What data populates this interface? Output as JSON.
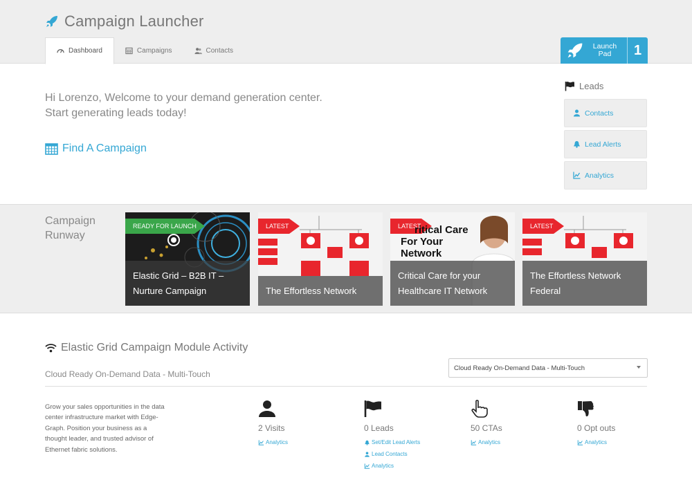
{
  "header": {
    "app_title": "Campaign Launcher",
    "tabs": [
      {
        "label": "Dashboard",
        "icon": "dashboard-icon",
        "active": true
      },
      {
        "label": "Campaigns",
        "icon": "calendar-icon",
        "active": false
      },
      {
        "label": "Contacts",
        "icon": "users-icon",
        "active": false
      }
    ],
    "launch_pad": {
      "label_line1": "Launch",
      "label_line2": "Pad",
      "count": "1"
    }
  },
  "welcome": {
    "line1": "Hi Lorenzo, Welcome to your demand generation center.",
    "line2": "Start generating leads today!",
    "find_campaign": "Find A Campaign"
  },
  "leads": {
    "title": "Leads",
    "buttons": [
      {
        "label": "Contacts",
        "icon": "user-icon"
      },
      {
        "label": "Lead Alerts",
        "icon": "bell-icon"
      },
      {
        "label": "Analytics",
        "icon": "chart-icon"
      }
    ]
  },
  "runway": {
    "title_line1": "Campaign",
    "title_line2": "Runway",
    "cards": [
      {
        "ribbon": "READY FOR LAUNCH",
        "title_line1": "Elastic Grid – B2B IT –",
        "title_line2": "Nurture Campaign"
      },
      {
        "ribbon": "LATEST",
        "title_line1": "The Effortless Network",
        "title_line2": ""
      },
      {
        "ribbon": "LATEST",
        "title_line1": "Critical Care for your",
        "title_line2": "Healthcare IT Network",
        "art_text_1": "ritical Care",
        "art_text_2": "For Your",
        "art_text_3": "Network"
      },
      {
        "ribbon": "LATEST",
        "title_line1": "The Effortless Network",
        "title_line2": "Federal"
      }
    ]
  },
  "activity": {
    "title": "Elastic Grid Campaign Module Activity",
    "subtitle": "Cloud Ready On-Demand Data - Multi-Touch",
    "select_value": "Cloud Ready On-Demand Data - Multi-Touch",
    "description": "Grow your sales opportunities in the data center infrastructure market with Edge-Graph. Position your business as a thought leader, and trusted advisor of Ethernet fabric solutions.",
    "stats": [
      {
        "value": "2 Visits",
        "icon": "user-icon",
        "links": [
          {
            "label": "Analytics",
            "icon": "chart-icon"
          }
        ]
      },
      {
        "value": "0 Leads",
        "icon": "flag-icon",
        "links": [
          {
            "label": "Set/Edit Lead Alerts",
            "icon": "bell-icon"
          },
          {
            "label": "Lead Contacts",
            "icon": "user-icon"
          },
          {
            "label": "Analytics",
            "icon": "chart-icon"
          }
        ]
      },
      {
        "value": "50 CTAs",
        "icon": "pointer-hand-icon",
        "links": [
          {
            "label": "Analytics",
            "icon": "chart-icon"
          }
        ]
      },
      {
        "value": "0 Opt outs",
        "icon": "thumbs-down-icon",
        "links": [
          {
            "label": "Analytics",
            "icon": "chart-icon"
          }
        ]
      }
    ]
  },
  "colors": {
    "accent": "#34a7d4",
    "ribbon_green": "#3aa64a",
    "ribbon_red": "#e8262d",
    "background_band": "#eeeeee"
  }
}
